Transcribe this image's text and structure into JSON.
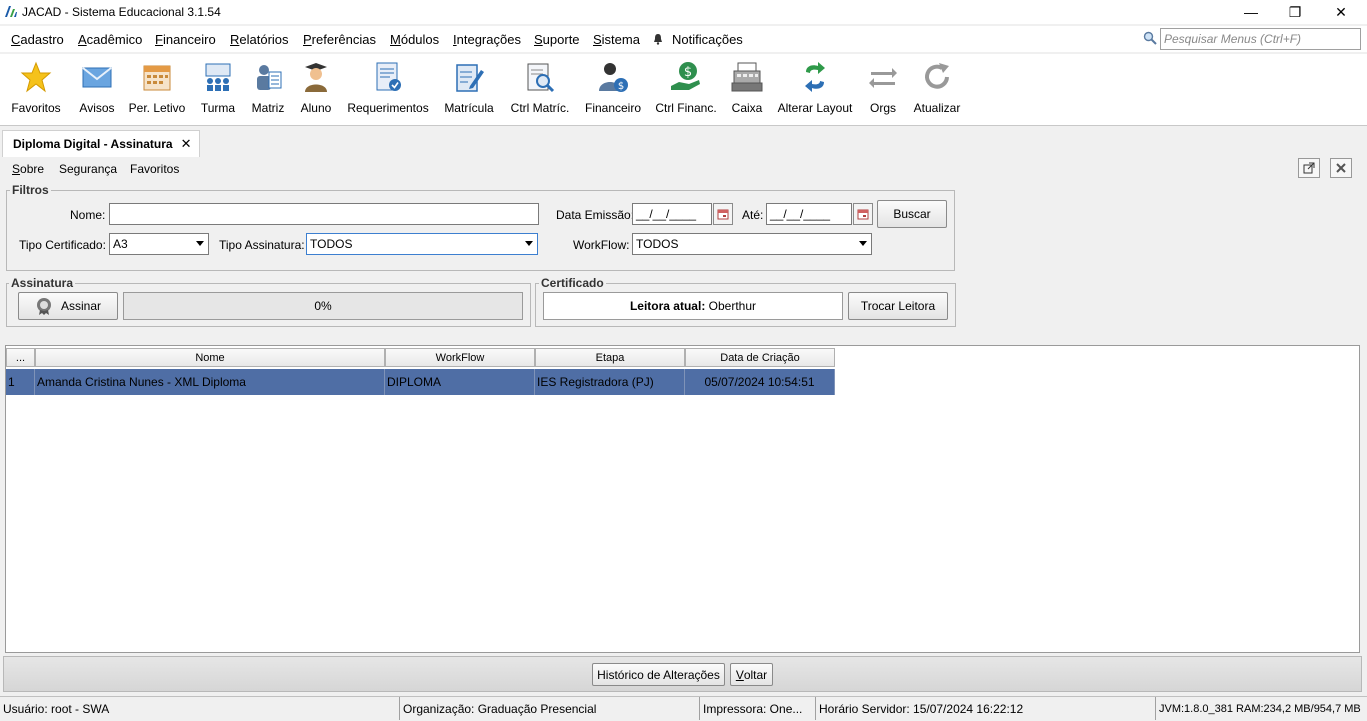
{
  "window": {
    "title": "JACAD - Sistema Educacional 3.1.54",
    "minimize": "—",
    "restore": "❐",
    "close": "✕"
  },
  "menu": {
    "items": [
      {
        "hotkey": "C",
        "rest": "adastro"
      },
      {
        "hotkey": "A",
        "rest": "cadêmico"
      },
      {
        "hotkey": "F",
        "rest": "inanceiro"
      },
      {
        "hotkey": "R",
        "rest": "elatórios"
      },
      {
        "hotkey": "P",
        "rest": "referências"
      },
      {
        "hotkey": "M",
        "rest": "ódulos"
      },
      {
        "hotkey": "I",
        "rest": "ntegrações"
      },
      {
        "hotkey": "S",
        "rest": "uporte"
      },
      {
        "hotkey": "S",
        "rest": "istema"
      }
    ],
    "notifications": "Notificações",
    "search_placeholder": "Pesquisar Menus (Ctrl+F)"
  },
  "toolbar": {
    "favoritos": "Favoritos",
    "avisos": "Avisos",
    "per_letivo": "Per. Letivo",
    "turma": "Turma",
    "matriz": "Matriz",
    "aluno": "Aluno",
    "requerimentos": "Requerimentos",
    "matricula": "Matrícula",
    "ctrl_matric": "Ctrl Matríc.",
    "financeiro": "Financeiro",
    "ctrl_financ": "Ctrl Financ.",
    "caixa": "Caixa",
    "alterar_layout": "Alterar Layout",
    "orgs": "Orgs",
    "atualizar": "Atualizar"
  },
  "tab": {
    "title": "Diploma Digital - Assinatura",
    "close": "✕"
  },
  "submenu": {
    "sobre_hotkey": "S",
    "sobre_rest": "obre",
    "seguranca": "Segurança",
    "favoritos": "Favoritos"
  },
  "filtros": {
    "legend": "Filtros",
    "nome_label": "Nome:",
    "nome_value": "",
    "data_emissao_label": "Data Emissão:",
    "data_emissao_value": "__/__/____",
    "ate_label": "Até:",
    "ate_value": "__/__/____",
    "buscar": "Buscar",
    "tipo_certificado_label": "Tipo Certificado:",
    "tipo_certificado_value": "A3",
    "tipo_assinatura_label": "Tipo Assinatura:",
    "tipo_assinatura_value": "TODOS",
    "workflow_label": "WorkFlow:",
    "workflow_value": "TODOS"
  },
  "assinatura": {
    "legend": "Assinatura",
    "assinar": "Assinar",
    "progress_text": "0%",
    "progress_value": 0
  },
  "certificado": {
    "legend": "Certificado",
    "leitora_label": "Leitora atual:",
    "leitora_value": "Oberthur",
    "trocar": "Trocar Leitora"
  },
  "table": {
    "headers": [
      "...",
      "Nome",
      "WorkFlow",
      "Etapa",
      "Data de Criação"
    ],
    "rows": [
      [
        "1",
        "Amanda Cristina Nunes - XML Diploma",
        "DIPLOMA",
        "IES Registradora (PJ)",
        "05/07/2024 10:54:51"
      ]
    ]
  },
  "bottom": {
    "historico": "Histórico de Alterações",
    "voltar_hotkey": "V",
    "voltar_rest": "oltar"
  },
  "status": {
    "usuario": "Usuário: root - SWA",
    "organizacao": "Organização: Graduação Presencial",
    "impressora": "Impressora: One...",
    "horario": "Horário Servidor: 15/07/2024 16:22:12",
    "jvm": "JVM:1.8.0_381  RAM:234,2 MB/954,7 MB"
  },
  "colors": {
    "selection": "#4f6ea5",
    "toolbar_blue": "#2d6fb5"
  }
}
